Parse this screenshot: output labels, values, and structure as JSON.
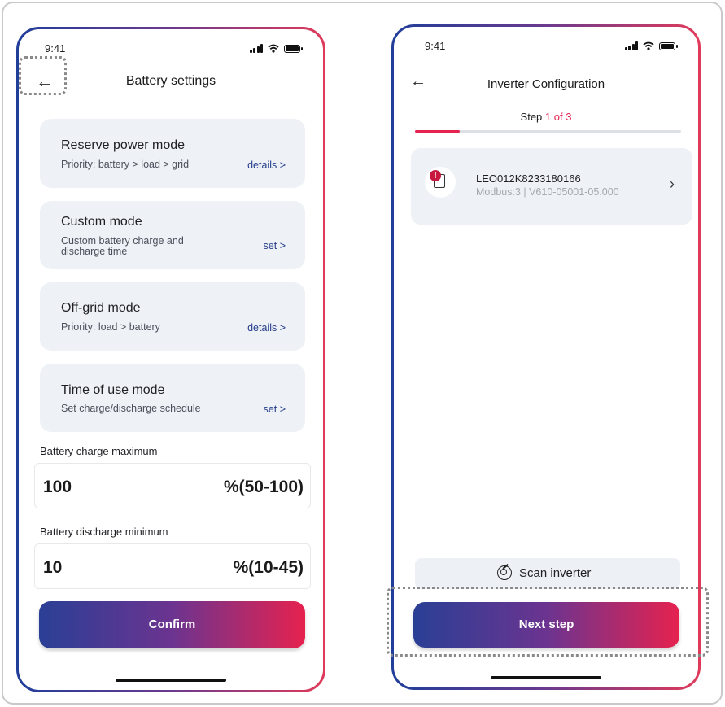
{
  "left_screen": {
    "status_time": "9:41",
    "title": "Battery settings",
    "modes": [
      {
        "title": "Reserve power mode",
        "description": "Priority: battery > load > grid",
        "link": "details >"
      },
      {
        "title": "Custom mode",
        "description_line1": "Custom battery charge and",
        "description_line2": "discharge time",
        "link": "set >"
      },
      {
        "title": "Off-grid mode",
        "description": "Priority: load > battery",
        "link": "details >"
      },
      {
        "title": "Time of use mode",
        "description": "Set charge/discharge schedule",
        "link": "set >"
      }
    ],
    "charge_max": {
      "label": "Battery charge maximum",
      "value": "100",
      "range": "%(50-100)"
    },
    "discharge_min": {
      "label": "Battery discharge minimum",
      "value": "10",
      "range": "%(10-45)"
    },
    "confirm_label": "Confirm"
  },
  "right_screen": {
    "status_time": "9:41",
    "title": "Inverter Configuration",
    "step_prefix": "Step",
    "step_progress": "1 of 3",
    "progress_fraction": 0.167,
    "inverter": {
      "name": "LEO012K8233180166",
      "details": "Modbus:3 | V610-05001-05.000"
    },
    "scan_label": "Scan inverter",
    "next_label": "Next step"
  },
  "icons": {
    "back": "arrow-left-icon",
    "signal": "signal-icon",
    "wifi": "wifi-icon",
    "battery": "battery-icon",
    "chevron": "chevron-right-icon",
    "alert": "alert-icon",
    "scan": "radar-scan-icon"
  },
  "colors": {
    "accent_red": "#e6224f",
    "link_blue": "#253e8c",
    "gradient_start": "#2a3f95",
    "gradient_end": "#e6224f",
    "card_bg": "#eef1f5"
  }
}
